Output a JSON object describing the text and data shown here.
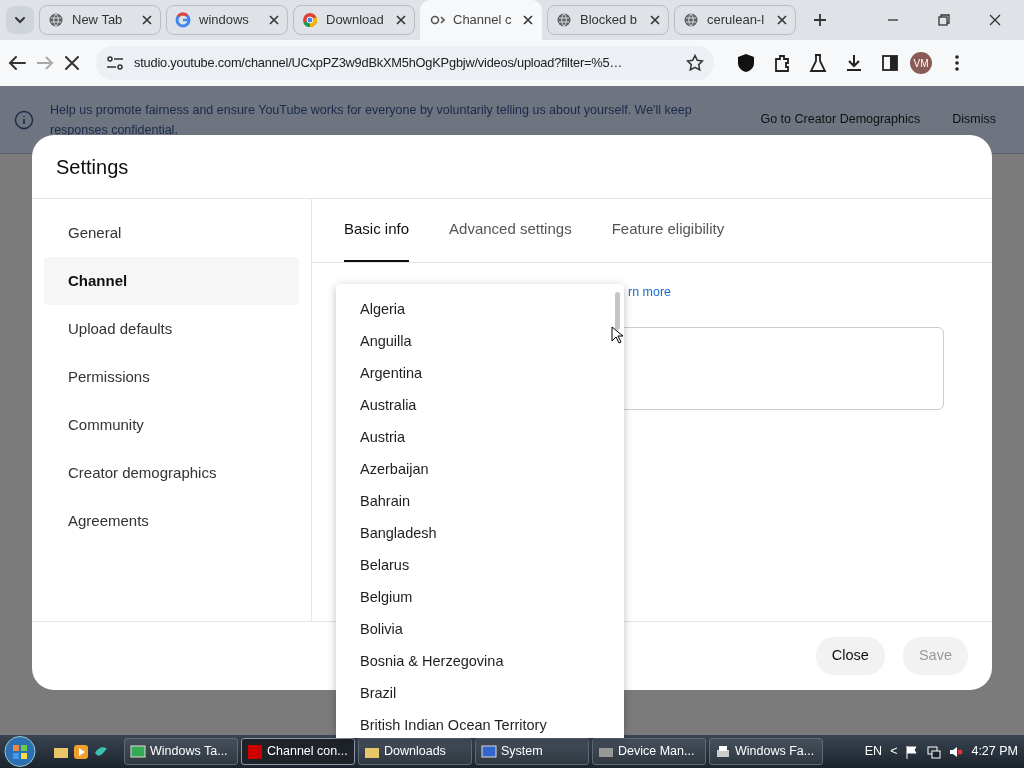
{
  "browser": {
    "tabs": [
      {
        "title": "New Tab",
        "selected": false
      },
      {
        "title": "windows",
        "selected": false
      },
      {
        "title": "Download",
        "selected": false
      },
      {
        "title": "Channel c",
        "selected": true
      },
      {
        "title": "Blocked b",
        "selected": false
      },
      {
        "title": "cerulean-l",
        "selected": false
      }
    ],
    "url": "studio.youtube.com/channel/UCxpPZ3w9dBkXM5hOgKPgbjw/videos/upload?filter=%5…",
    "loading": true,
    "profile": "VM"
  },
  "banner": {
    "text": "Help us promote fairness and ensure YouTube works for everyone by voluntarily telling us about yourself. We'll keep responses confidential.",
    "actions": [
      "Go to Creator Demographics",
      "Dismiss"
    ]
  },
  "dialog": {
    "title": "Settings",
    "nav": [
      {
        "label": "General",
        "selected": false
      },
      {
        "label": "Channel",
        "selected": true
      },
      {
        "label": "Upload defaults",
        "selected": false
      },
      {
        "label": "Permissions",
        "selected": false
      },
      {
        "label": "Community",
        "selected": false
      },
      {
        "label": "Creator demographics",
        "selected": false
      },
      {
        "label": "Agreements",
        "selected": false
      }
    ],
    "tabs": [
      {
        "label": "Basic info",
        "selected": true
      },
      {
        "label": "Advanced settings",
        "selected": false
      },
      {
        "label": "Feature eligibility",
        "selected": false
      }
    ],
    "link": "rn more",
    "buttons": [
      {
        "label": "Close",
        "disabled": false
      },
      {
        "label": "Save",
        "disabled": true
      }
    ]
  },
  "dropdown": {
    "options": [
      "Algeria",
      "Anguilla",
      "Argentina",
      "Australia",
      "Austria",
      "Azerbaijan",
      "Bahrain",
      "Bangladesh",
      "Belarus",
      "Belgium",
      "Bolivia",
      "Bosnia & Herzegovina",
      "Brazil",
      "British Indian Ocean Territory"
    ]
  },
  "taskbar": {
    "tasks": [
      {
        "label": "Windows Ta...",
        "selected": false
      },
      {
        "label": "Channel con...",
        "selected": true
      },
      {
        "label": "Downloads",
        "selected": false
      },
      {
        "label": "System",
        "selected": false
      },
      {
        "label": "Device Man...",
        "selected": false
      },
      {
        "label": "Windows Fa...",
        "selected": false
      }
    ],
    "language": "EN",
    "tray_arrow": "<",
    "clock": "4:27 PM"
  }
}
